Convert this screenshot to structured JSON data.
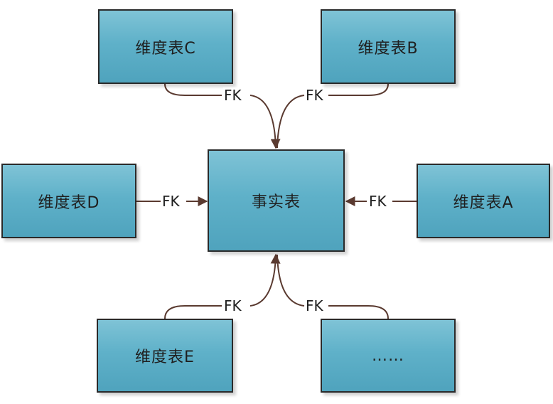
{
  "boxes": {
    "dim_c": "维度表C",
    "dim_b": "维度表B",
    "dim_d": "维度表D",
    "fact": "事实表",
    "dim_a": "维度表A",
    "dim_e": "维度表E",
    "more": "……"
  },
  "labels": {
    "fk_c": "FK",
    "fk_b": "FK",
    "fk_d": "FK",
    "fk_a": "FK",
    "fk_e": "FK",
    "fk_more": "FK"
  },
  "colors": {
    "box_fill": "#5fb1c9",
    "box_border": "#2a2a2a",
    "connector": "#5a3a30"
  }
}
